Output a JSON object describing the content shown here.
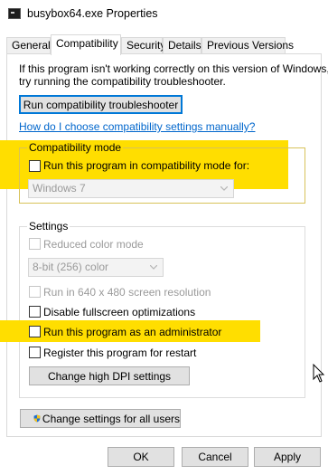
{
  "window": {
    "title": "busybox64.exe Properties"
  },
  "tabs": [
    {
      "label": "General",
      "active": false
    },
    {
      "label": "Compatibility",
      "active": true
    },
    {
      "label": "Security",
      "active": false
    },
    {
      "label": "Details",
      "active": false
    },
    {
      "label": "Previous Versions",
      "active": false
    }
  ],
  "intro": {
    "line1": "If this program isn't working correctly on this version of Windows,",
    "line2": "try running the compatibility troubleshooter."
  },
  "troubleshooter_button": "Run compatibility troubleshooter",
  "help_link": "How do I choose compatibility settings manually?",
  "compat_mode": {
    "legend": "Compatibility mode",
    "checkbox_label": "Run this program in compatibility mode for:",
    "checked": false,
    "os_select_value": "Windows 7"
  },
  "settings": {
    "legend": "Settings",
    "reduced_color": {
      "label": "Reduced color mode",
      "checked": false,
      "enabled": false
    },
    "color_select_value": "8-bit (256) color",
    "resolution": {
      "label": "Run in 640 x 480 screen resolution",
      "checked": false,
      "enabled": false
    },
    "fullscreen": {
      "label": "Disable fullscreen optimizations",
      "checked": false,
      "enabled": true
    },
    "admin": {
      "label": "Run this program as an administrator",
      "checked": false,
      "enabled": true
    },
    "restart": {
      "label": "Register this program for restart",
      "checked": false,
      "enabled": true
    },
    "dpi_button": "Change high DPI settings"
  },
  "all_users_button": "Change settings for all users",
  "footer": {
    "ok": "OK",
    "cancel": "Cancel",
    "apply": "Apply"
  },
  "colors": {
    "highlight": "#ffde00",
    "link": "#0066cc",
    "accent_border": "#0078d7"
  }
}
